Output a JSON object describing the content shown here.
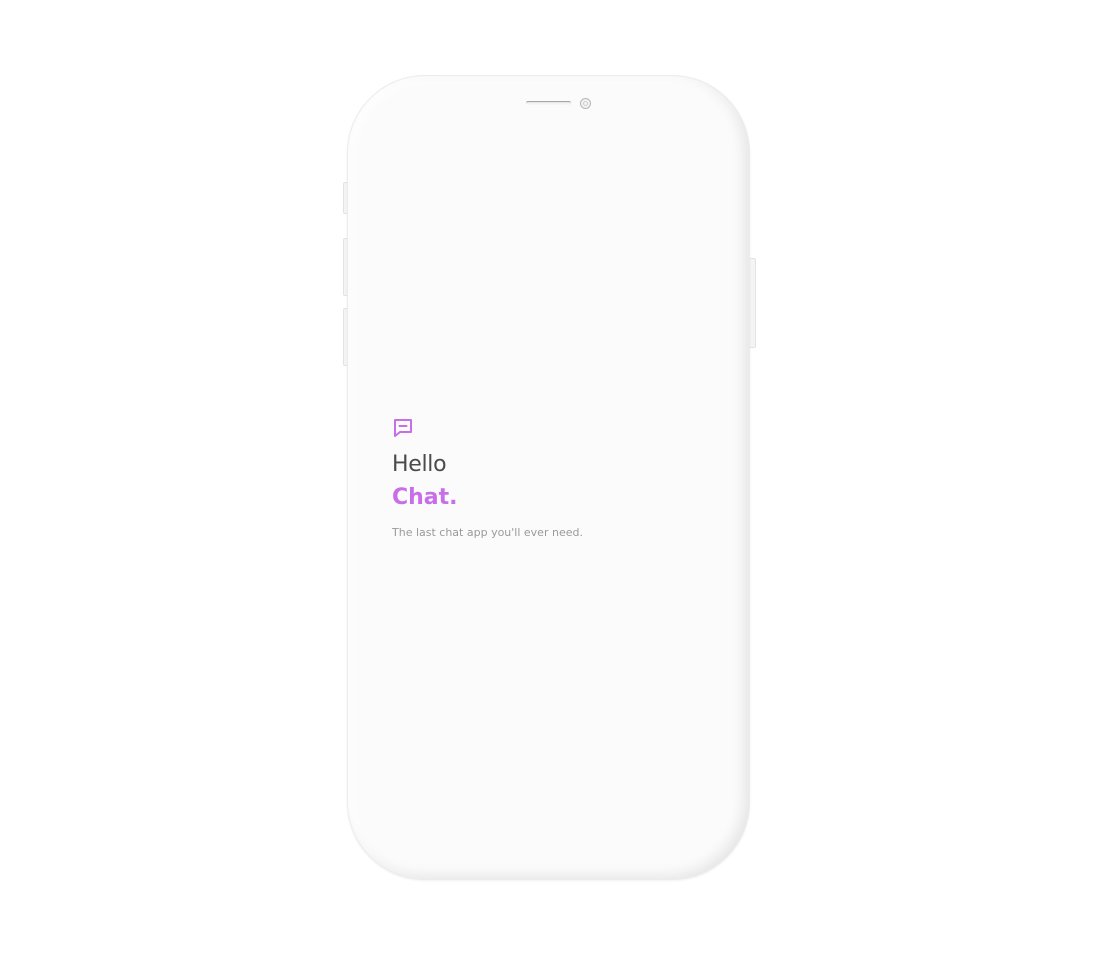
{
  "colors": {
    "accent": "#c86ee8",
    "heading": "#4b4b4b",
    "subtext": "#9a9a9a",
    "screen": "#fbfbfb"
  },
  "splash": {
    "icon": "chat-bubble-icon",
    "greeting": "Hello",
    "app_name": "Chat.",
    "tagline": "The last chat app you'll ever need."
  }
}
